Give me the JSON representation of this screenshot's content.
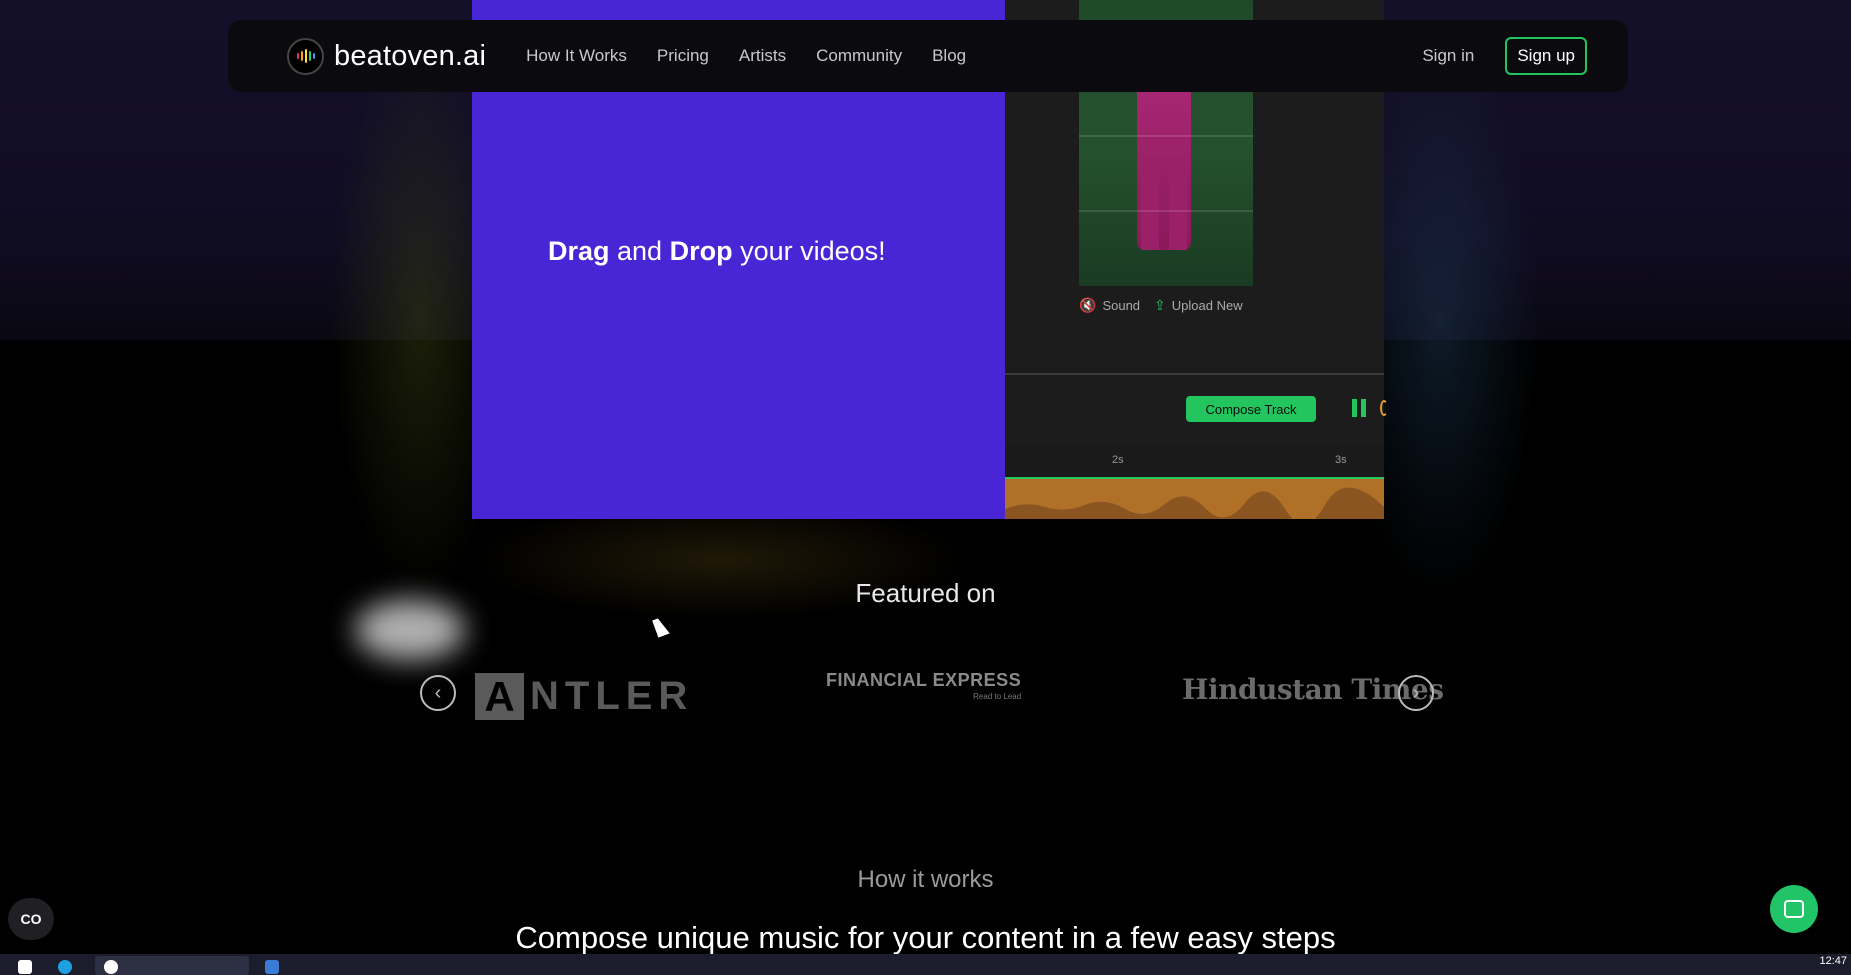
{
  "brand": {
    "name": "beatoven.ai"
  },
  "nav": {
    "links": [
      "How It Works",
      "Pricing",
      "Artists",
      "Community",
      "Blog"
    ],
    "signin": "Sign in",
    "signup": "Sign up"
  },
  "hero": {
    "dd_word1": "Drag",
    "dd_word2": " and ",
    "dd_word3": "Drop",
    "dd_word4": " your videos!",
    "sound_label": "Sound",
    "upload_label": "Upload New",
    "compose_button": "Compose Track",
    "timeline_ticks": [
      "2s",
      "3s"
    ]
  },
  "featured": {
    "title": "Featured on",
    "logos": {
      "antler_first": "A",
      "antler_rest": "NTLER",
      "fe_main": "FINANCIAL EXPRESS",
      "fe_sub": "Read to Lead",
      "ht": "Hindustan Times"
    }
  },
  "how": {
    "label": "How it works",
    "headline": "Compose unique music for your content in a few easy steps"
  },
  "widgets": {
    "cc": "CO"
  },
  "taskbar": {
    "clock": "12:47"
  },
  "colors": {
    "accent": "#22c55e",
    "hero_purple": "#4826d6",
    "waveform": "#b07028"
  }
}
